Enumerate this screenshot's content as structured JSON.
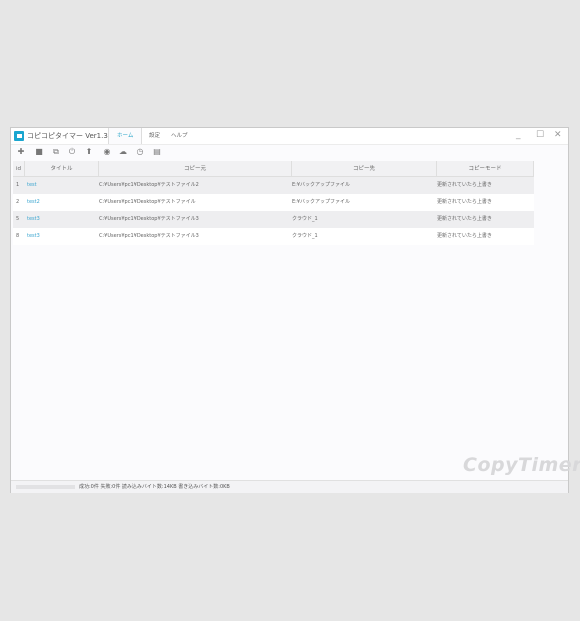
{
  "app": {
    "title": "コピコピタイマー Ver1.31",
    "watermark": "CopyTimer"
  },
  "menu": [
    {
      "label": "ホーム",
      "active": true
    },
    {
      "label": "設定"
    },
    {
      "label": "ヘルプ"
    }
  ],
  "window_controls": {
    "minimize": "_",
    "maximize": "☐",
    "close": "✕"
  },
  "toolbar": [
    {
      "icon": "add-icon",
      "glyph": "✚"
    },
    {
      "icon": "delete-icon",
      "glyph": "■"
    },
    {
      "icon": "copy-icon",
      "glyph": "⧉"
    },
    {
      "icon": "power-icon",
      "glyph": "⏻"
    },
    {
      "icon": "upload-icon",
      "glyph": "⬆"
    },
    {
      "icon": "record-icon",
      "glyph": "◉"
    },
    {
      "icon": "cloud-upload-icon",
      "glyph": "☁"
    },
    {
      "icon": "clock-icon",
      "glyph": "◷"
    },
    {
      "icon": "document-icon",
      "glyph": "▤"
    }
  ],
  "table": {
    "columns": [
      "id",
      "タイトル",
      "コピー元",
      "コピー先",
      "コピーモード"
    ],
    "rows": [
      {
        "id": "1",
        "title": "test",
        "src": "C:¥Users¥pc1¥Desktop¥テストファイル2",
        "dst": "E:¥バックアップファイル",
        "mode": "更新されていたら上書き"
      },
      {
        "id": "2",
        "title": "test2",
        "src": "C:¥Users¥pc1¥Desktop¥テストファイル",
        "dst": "E:¥バックアップファイル",
        "mode": "更新されていたら上書き"
      },
      {
        "id": "5",
        "title": "test3",
        "src": "C:¥Users¥pc1¥Desktop¥テストファイル3",
        "dst": "クラウド_1",
        "mode": "更新されていたら上書き"
      },
      {
        "id": "8",
        "title": "test3",
        "src": "C:¥Users¥pc1¥Desktop¥テストファイル3",
        "dst": "クラウド_1",
        "mode": "更新されていたら上書き"
      }
    ]
  },
  "status": {
    "text": "成功:0件 失敗:0件 読み込みバイト数:14KB 書き込みバイト数:0KB",
    "progress": 0
  }
}
